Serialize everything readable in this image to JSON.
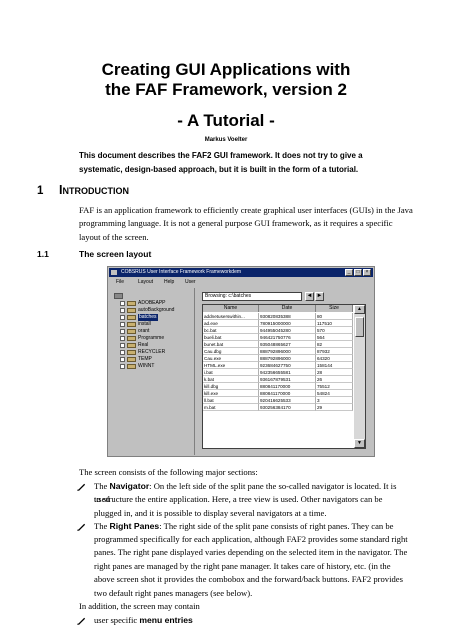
{
  "title": {
    "line1": "Creating GUI Applications with",
    "line2": "the FAF Framework, version 2",
    "subtitle": "- A Tutorial -",
    "author": "Markus Voelter"
  },
  "abstract": {
    "line1": "This document describes the FAF2 GUI framework. It does not try to give a",
    "line2": "systematic, design-based approach, but it is built in the form of a tutorial."
  },
  "section1": {
    "number": "1",
    "title_first": "I",
    "title_rest": "NTRODUCTION",
    "para_lines": [
      "FAF is an application framework to efficiently create graphical user interfaces (GUIs) in the Java",
      "programming language. It is not a general purpose GUI framework, as it requires a specific",
      "layout of the screen."
    ]
  },
  "section11": {
    "number": "1.1",
    "title": "The screen layout"
  },
  "screenshot": {
    "window_title": "COBSRUS User Interface Framework Frameworkdem",
    "window_buttons": [
      "_",
      "□",
      "×"
    ],
    "menu": [
      "File",
      "Layout",
      "Help",
      "User"
    ],
    "tree_items": [
      "ADOBEAPP",
      "autoBackground",
      "batches",
      "install",
      "orant",
      "Programme",
      "Real",
      "RECYCLER",
      "TEMP",
      "WINNT"
    ],
    "selected_item": "batches",
    "combo_value": "Browsing: c:\\batches",
    "back_label": "◄",
    "forward_label": "►",
    "columns": [
      "Name",
      "Date",
      "Size"
    ],
    "rows": [
      [
        "addnetuserswithin...",
        "930820835388",
        "80"
      ],
      [
        "ad.exe",
        "780915000000",
        "117510"
      ],
      [
        "bc.bat",
        "944955045280",
        "570"
      ],
      [
        "bueli.bat",
        "946421750776",
        "564"
      ],
      [
        "bunet.bat",
        "935048865627",
        "82"
      ],
      [
        "Cau.dbg",
        "888792896000",
        "87932"
      ],
      [
        "Cau.exe",
        "888792896000",
        "64320"
      ],
      [
        "HTML.exe",
        "923684627750",
        "158144"
      ],
      [
        "i.bat",
        "942356655581",
        "28"
      ],
      [
        "k.bat",
        "936167879531",
        "26"
      ],
      [
        "kill.dbg",
        "880841170000",
        "75512"
      ],
      [
        "kill.exe",
        "880841170000",
        "54824"
      ],
      [
        "ll.bat",
        "920416625533",
        "3"
      ],
      [
        "m.bat",
        "930256384170",
        "29"
      ]
    ]
  },
  "body": {
    "intro": "The screen consists of the following major sections:",
    "navigator_label": "Navigator",
    "navigator_pre": "The",
    "navigator_line1": ": On the left side of the split pane the so-called navigator is located. It is used",
    "navigator_line2": "to structure the entire application. Here, a tree view is used. Other navigators can be",
    "navigator_line3": "plugged in, and it is possible to display several navigators at a time.",
    "rightpanes_pre": "The",
    "rightpanes_label": "Right Panes",
    "rightpanes_line1": ": The right side of the split pane consists of right panes. They can be",
    "rightpanes_line2": "programmed specifically for each application, although FAF2 provides some standard right",
    "rightpanes_line3": "panes. The right pane displayed varies depending on the selected item in the navigator. The",
    "rightpanes_line4": "right panes are managed by the right pane manager. It takes care of history, etc. (in the",
    "rightpanes_line5": "above screen shot it provides the combobox and the forward/back buttons. FAF2 provides",
    "rightpanes_line6": "two default right panes managers (see below).",
    "addition": "In addition, the screen may contain",
    "menu_pre": "user specific",
    "menu_label": "menu entries"
  }
}
